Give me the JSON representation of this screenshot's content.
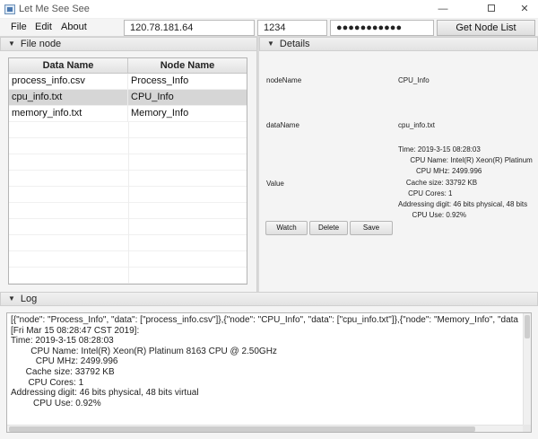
{
  "window": {
    "title": "Let Me See See",
    "minimize_glyph": "—",
    "close_glyph": "✕"
  },
  "menu": {
    "file": "File",
    "edit": "Edit",
    "about": "About"
  },
  "connection": {
    "host": "120.78.181.64",
    "port": "1234",
    "password": "●●●●●●●●●●●",
    "get_node_list": "Get Node List"
  },
  "file_node": {
    "title": "File node",
    "columns": [
      "Data Name",
      "Node Name"
    ],
    "rows": [
      {
        "data_name": "process_info.csv",
        "node_name": "Process_Info"
      },
      {
        "data_name": "cpu_info.txt",
        "node_name": "CPU_Info"
      },
      {
        "data_name": "memory_info.txt",
        "node_name": "Memory_Info"
      }
    ],
    "selected_index": 1
  },
  "details": {
    "title": "Details",
    "node_name_label": "nodeName",
    "node_name_value": "CPU_Info",
    "data_name_label": "dataName",
    "data_name_value": "cpu_info.txt",
    "value_label": "Value",
    "value_text": "Time: 2019-3-15 08:28:03\n      CPU Name: Intel(R) Xeon(R) Platinum\n         CPU MHz: 2499.996\n    Cache size: 33792 KB\n     CPU Cores: 1\nAddressing digit: 46 bits physical, 48 bits\n       CPU Use: 0.92%",
    "watch_label": "Watch",
    "delete_label": "Delete",
    "save_label": "Save"
  },
  "log": {
    "title": "Log",
    "text": "[{\"node\": \"Process_Info\", \"data\": [\"process_info.csv\"]},{\"node\": \"CPU_Info\", \"data\": [\"cpu_info.txt\"]},{\"node\": \"Memory_Info\", \"data\": [\"memory_info.txt\"]}]\n[Fri Mar 15 08:28:47 CST 2019]:\nTime: 2019-3-15 08:28:03\n        CPU Name: Intel(R) Xeon(R) Platinum 8163 CPU @ 2.50GHz\n          CPU MHz: 2499.996\n      Cache size: 33792 KB\n       CPU Cores: 1\nAddressing digit: 46 bits physical, 48 bits virtual\n         CPU Use: 0.92%"
  },
  "icons": {
    "app": "app-window-icon",
    "collapse": "triangle-down-icon"
  }
}
